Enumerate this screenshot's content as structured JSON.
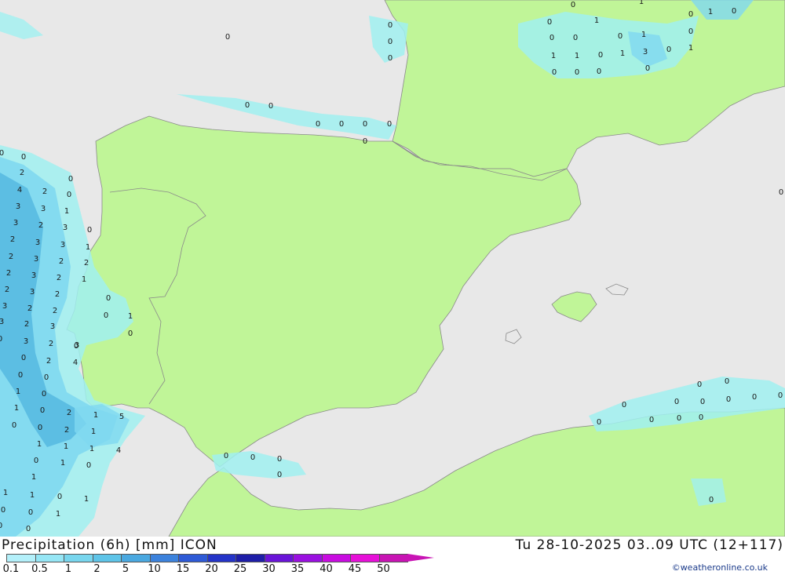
{
  "map": {
    "title_left": "Precipitation (6h) [mm] ICON",
    "title_right": "Tu 28-10-2025 03..09 UTC (12+117)",
    "credit": "©weatheronline.co.uk",
    "colors": {
      "sea": "#e8e8e8",
      "land": "#c0f598",
      "border": "#8a8a8a",
      "precip_light": "#a0f0f0",
      "precip_mid": "#7fd8f0",
      "precip_heavy": "#55b8e0"
    },
    "legend": {
      "labels": [
        "0.1",
        "0.5",
        "1",
        "2",
        "5",
        "10",
        "15",
        "20",
        "25",
        "30",
        "35",
        "40",
        "45",
        "50"
      ],
      "colors": [
        "#b4f0fa",
        "#96e6f5",
        "#78d6ee",
        "#5ec4e8",
        "#4aa8e0",
        "#3c82dc",
        "#2e5ad6",
        "#2434c8",
        "#1e1ea8",
        "#6a14d8",
        "#9a10e0",
        "#c80ce0",
        "#e610d8",
        "#c814b4"
      ]
    },
    "values": [
      {
        "t": "0"
      },
      {
        "t": "0"
      },
      {
        "t": "0"
      },
      {
        "t": "0"
      },
      {
        "t": "0"
      },
      {
        "t": "0"
      },
      {
        "t": "0"
      },
      {
        "t": "0"
      },
      {
        "t": "0"
      },
      {
        "t": "0"
      },
      {
        "t": "0"
      },
      {
        "t": "0"
      },
      {
        "t": "1"
      },
      {
        "t": "0"
      },
      {
        "t": "0"
      },
      {
        "t": "0"
      },
      {
        "t": "0"
      },
      {
        "t": "1"
      },
      {
        "t": "1"
      },
      {
        "t": "0"
      },
      {
        "t": "1"
      },
      {
        "t": "0"
      },
      {
        "t": "0"
      },
      {
        "t": "0"
      },
      {
        "t": "1"
      },
      {
        "t": "3"
      },
      {
        "t": "0"
      },
      {
        "t": "0"
      },
      {
        "t": "0"
      },
      {
        "t": "0"
      },
      {
        "t": "1"
      },
      {
        "t": "0"
      },
      {
        "t": "1"
      },
      {
        "t": "1"
      },
      {
        "t": "0"
      },
      {
        "t": "0"
      },
      {
        "t": "0"
      },
      {
        "t": "2"
      },
      {
        "t": "0"
      },
      {
        "t": "4"
      },
      {
        "t": "2"
      },
      {
        "t": "0"
      },
      {
        "t": "3"
      },
      {
        "t": "3"
      },
      {
        "t": "1"
      },
      {
        "t": "3"
      },
      {
        "t": "2"
      },
      {
        "t": "3"
      },
      {
        "t": "0"
      },
      {
        "t": "2"
      },
      {
        "t": "3"
      },
      {
        "t": "3"
      },
      {
        "t": "1"
      },
      {
        "t": "2"
      },
      {
        "t": "3"
      },
      {
        "t": "2"
      },
      {
        "t": "2"
      },
      {
        "t": "2"
      },
      {
        "t": "3"
      },
      {
        "t": "2"
      },
      {
        "t": "1"
      },
      {
        "t": "2"
      },
      {
        "t": "3"
      },
      {
        "t": "2"
      },
      {
        "t": "3"
      },
      {
        "t": "2"
      },
      {
        "t": "2"
      },
      {
        "t": "3"
      },
      {
        "t": "2"
      },
      {
        "t": "3"
      },
      {
        "t": "0"
      },
      {
        "t": "3"
      },
      {
        "t": "2"
      },
      {
        "t": "3"
      },
      {
        "t": "0"
      },
      {
        "t": "2"
      },
      {
        "t": "4"
      },
      {
        "t": "0"
      },
      {
        "t": "0"
      },
      {
        "t": "1"
      },
      {
        "t": "0"
      },
      {
        "t": "1"
      },
      {
        "t": "0"
      },
      {
        "t": "2"
      },
      {
        "t": "1"
      },
      {
        "t": "5"
      },
      {
        "t": "0"
      },
      {
        "t": "0"
      },
      {
        "t": "2"
      },
      {
        "t": "1"
      },
      {
        "t": "4"
      },
      {
        "t": "1"
      },
      {
        "t": "1"
      },
      {
        "t": "1"
      },
      {
        "t": "0"
      },
      {
        "t": "1"
      },
      {
        "t": "0"
      },
      {
        "t": "1"
      },
      {
        "t": "1"
      },
      {
        "t": "1"
      },
      {
        "t": "0"
      },
      {
        "t": "1"
      },
      {
        "t": "0"
      },
      {
        "t": "0"
      },
      {
        "t": "1"
      },
      {
        "t": "0"
      },
      {
        "t": "0"
      },
      {
        "t": "1"
      },
      {
        "t": "0"
      },
      {
        "t": "0"
      },
      {
        "t": "0"
      },
      {
        "t": "0"
      },
      {
        "t": "0"
      },
      {
        "t": "0"
      },
      {
        "t": "0"
      },
      {
        "t": "0"
      },
      {
        "t": "0"
      },
      {
        "t": "0"
      },
      {
        "t": "0"
      },
      {
        "t": "0"
      },
      {
        "t": "0"
      },
      {
        "t": "0"
      },
      {
        "t": "0"
      },
      {
        "t": "0"
      },
      {
        "t": "0"
      },
      {
        "t": "0"
      },
      {
        "t": "0"
      },
      {
        "t": "0"
      },
      {
        "t": "0"
      }
    ]
  }
}
